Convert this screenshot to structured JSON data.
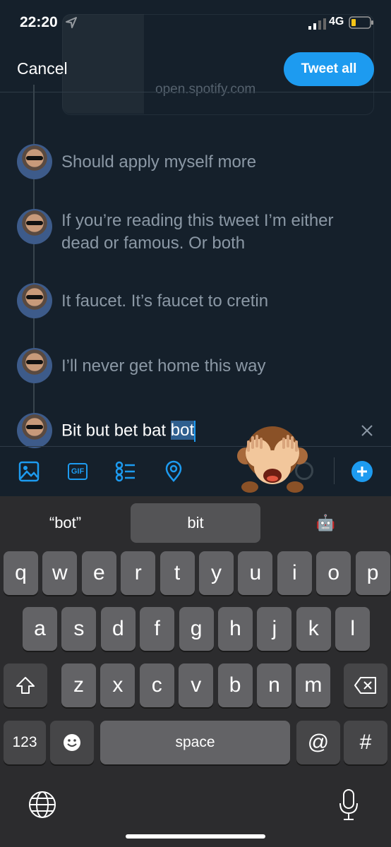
{
  "status_bar": {
    "time": "22:20",
    "network": "4G"
  },
  "header": {
    "cancel_label": "Cancel",
    "tweet_all_label": "Tweet all"
  },
  "link_card": {
    "domain": "open.spotify.com"
  },
  "thread": [
    {
      "text": "Should apply myself more"
    },
    {
      "text": "If you’re reading this tweet I’m either dead or famous. Or both"
    },
    {
      "text": "It faucet. It’s faucet to cretin"
    },
    {
      "text": "I’ll never get home this way"
    }
  ],
  "current": {
    "text_before": "Bit but bet bat ",
    "selected_word": "bot"
  },
  "toolbar": {
    "icons": [
      "image-icon",
      "gif-icon",
      "poll-icon",
      "location-icon"
    ],
    "gif_label": "GIF"
  },
  "keyboard": {
    "suggestions": [
      "“bot”",
      "bit",
      "🤖"
    ],
    "row1": [
      "q",
      "w",
      "e",
      "r",
      "t",
      "y",
      "u",
      "i",
      "o",
      "p"
    ],
    "row2": [
      "a",
      "s",
      "d",
      "f",
      "g",
      "h",
      "j",
      "k",
      "l"
    ],
    "row3": [
      "z",
      "x",
      "c",
      "v",
      "b",
      "n",
      "m"
    ],
    "numbers_label": "123",
    "space_label": "space",
    "at_label": "@",
    "hash_label": "#"
  },
  "colors": {
    "background": "#15202b",
    "accent": "#1d9bf0",
    "keyboard_bg": "#2c2c2e",
    "key": "#636366"
  }
}
